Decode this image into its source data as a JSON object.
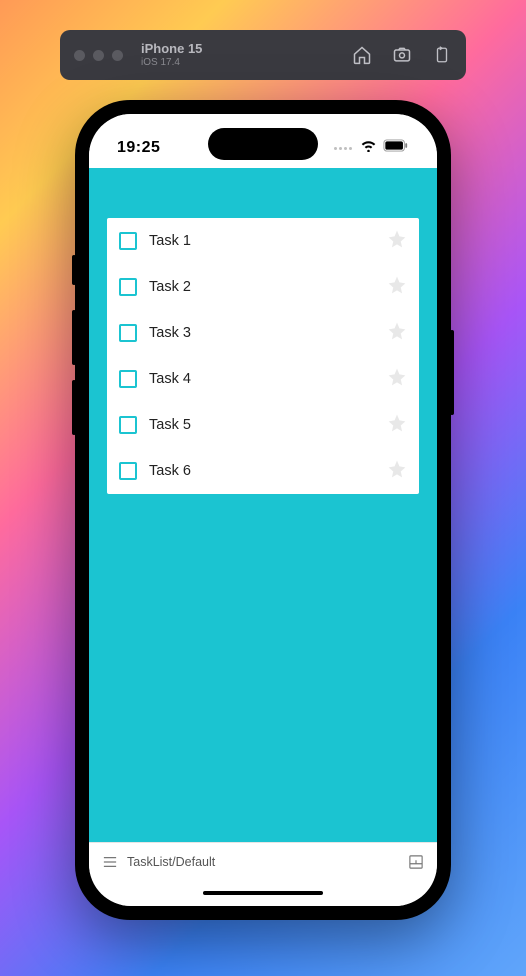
{
  "toolbar": {
    "device_name": "iPhone 15",
    "os_version": "iOS 17.4"
  },
  "status": {
    "time": "19:25"
  },
  "tasks": [
    {
      "label": "Task 1",
      "checked": false,
      "starred": false
    },
    {
      "label": "Task 2",
      "checked": false,
      "starred": false
    },
    {
      "label": "Task 3",
      "checked": false,
      "starred": false
    },
    {
      "label": "Task 4",
      "checked": false,
      "starred": false
    },
    {
      "label": "Task 5",
      "checked": false,
      "starred": false
    },
    {
      "label": "Task 6",
      "checked": false,
      "starred": false
    }
  ],
  "bottom": {
    "story_path": "TaskList/Default"
  }
}
